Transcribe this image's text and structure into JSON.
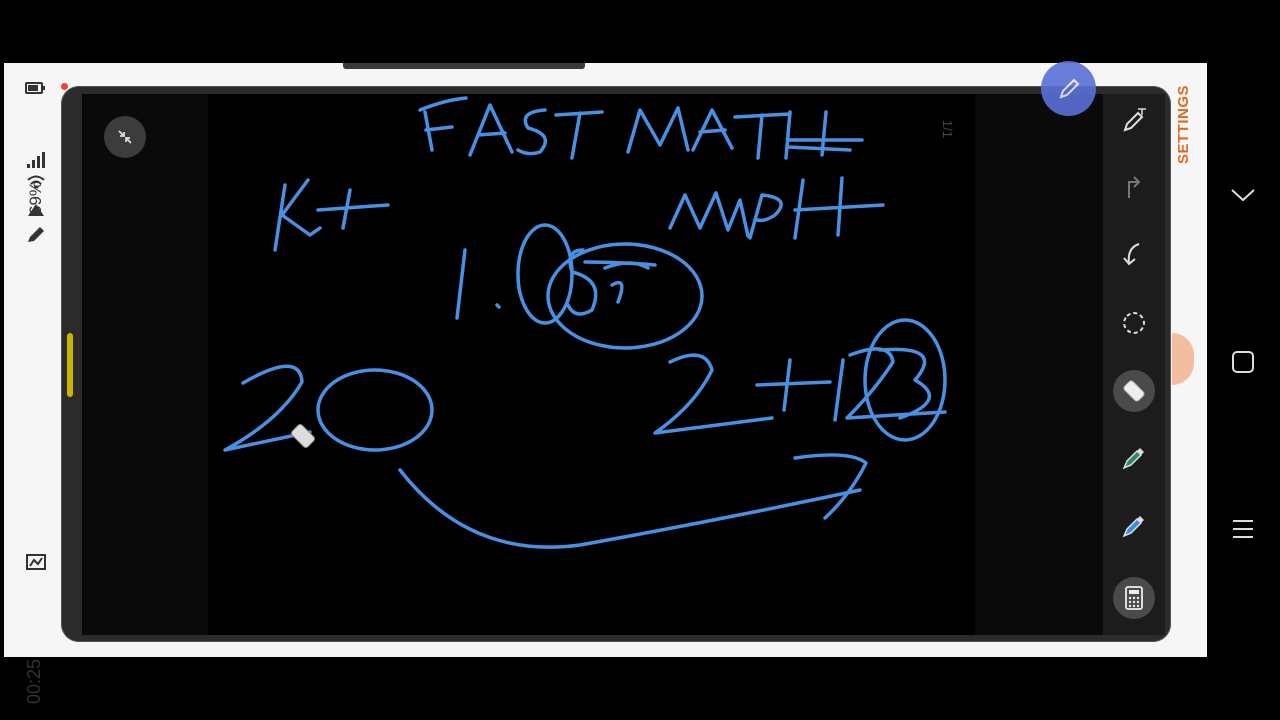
{
  "status_bar": {
    "battery": "69%",
    "time": "00:25"
  },
  "page_indicator": "1/1",
  "settings_label": "SETTINGS",
  "colors": {
    "ink": "#4a90e2",
    "accent": "#e06a24",
    "pen_fab": "#5b6fd6"
  },
  "toolbar": {
    "tools": [
      {
        "name": "pen-settings-icon"
      },
      {
        "name": "redo-icon"
      },
      {
        "name": "undo-icon"
      },
      {
        "name": "lasso-icon"
      },
      {
        "name": "eraser-icon",
        "active": true
      },
      {
        "name": "highlighter-icon"
      },
      {
        "name": "pen-icon"
      },
      {
        "name": "calculator-icon"
      }
    ]
  },
  "navigation": {
    "buttons": [
      "collapse-icon",
      "home-icon",
      "recents-icon"
    ]
  }
}
